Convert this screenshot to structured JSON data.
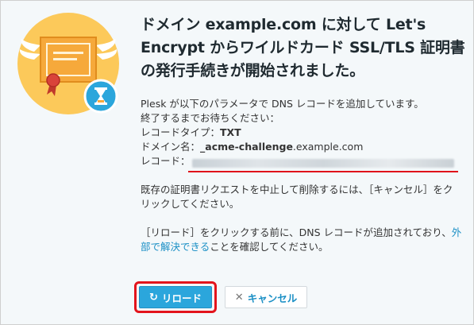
{
  "dialog": {
    "title": "ドメイン example.com に対して Let's Encrypt からワイルドカード SSL/TLS 証明書の発行手続きが開始されました。",
    "intro_line1": "Plesk が以下のパラメータで DNS レコードを追加しています。",
    "intro_line2": "終了するまでお待ちください：",
    "record_type_label": "レコードタイプ：",
    "record_type_value": "TXT",
    "domain_name_label": "ドメイン名：",
    "domain_name_value_bold": "_acme-challenge",
    "domain_name_value_rest": ".example.com",
    "record_label": "レコード：",
    "cancel_paragraph": "既存の証明書リクエストを中止して削除するには、［キャンセル］をクリックしてください。",
    "reload_paragraph_part1": "［リロード］をクリックする前に、DNS レコードが追加されており、",
    "reload_paragraph_link": "外部で解決できる",
    "reload_paragraph_part2": "ことを確認してください。"
  },
  "buttons": {
    "reload_label": "リロード",
    "reload_icon": "refresh-icon",
    "cancel_label": "キャンセル",
    "cancel_icon": "close-icon"
  },
  "colors": {
    "primary_button": "#2ba6dc",
    "link": "#1a8fc5",
    "highlight_red": "#e3141c",
    "illustration_circle": "#fcc95a"
  }
}
